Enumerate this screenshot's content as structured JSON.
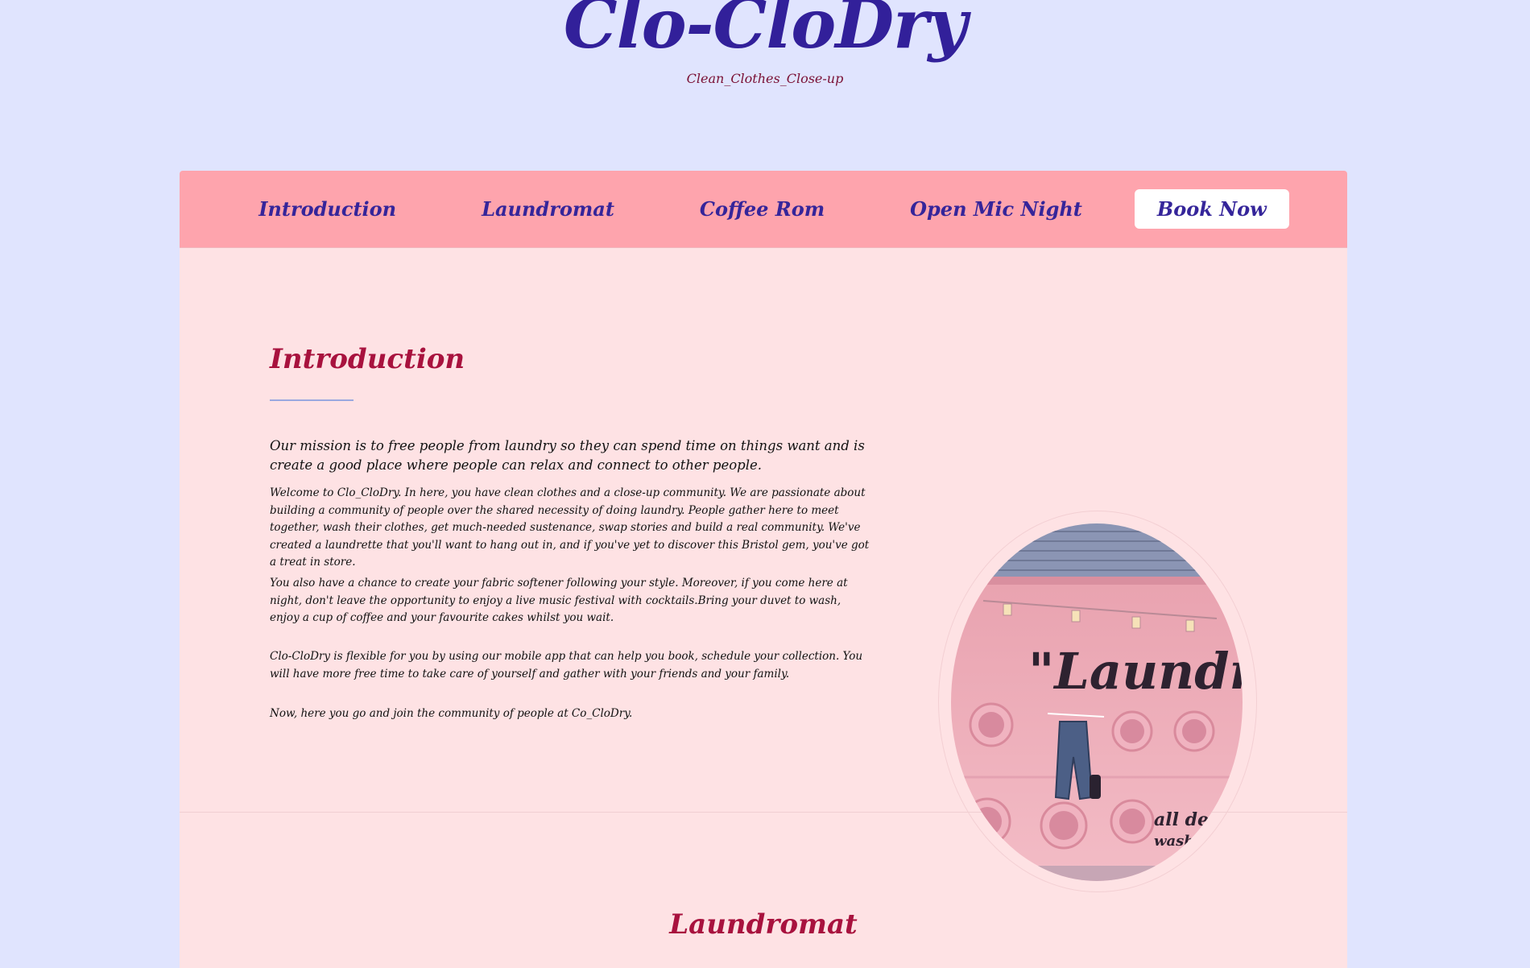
{
  "header": {
    "site_title": "Clo-CloDry",
    "tagline": "Clean_Clothes_Close-up"
  },
  "nav": {
    "items": [
      {
        "label": "Introduction"
      },
      {
        "label": "Laundromat"
      },
      {
        "label": "Coffee Rom"
      },
      {
        "label": "Open Mic Night"
      }
    ],
    "cta_label": "Book Now"
  },
  "intro": {
    "heading": "Introduction",
    "mission": "Our mission is to free people from laundry so they can spend time on things want and is create a good place where people can relax and connect to other people.",
    "paragraphs": [
      "Welcome to Clo_CloDry. In here, you have clean clothes and a close-up community. We are passionate about building a community of people over the shared necessity of doing laundry. People gather here to meet together, wash their clothes, get much-needed sustenance, swap stories and build a real community. We've created a laundrette that you'll want to hang out in, and if you've yet to discover this Bristol gem, you've got a treat in store.",
      "You also have a chance to create your fabric softener following your style. Moreover, if you come here at night, don't leave the opportunity to enjoy a live music festival with cocktails.Bring your duvet to wash, enjoy a cup of coffee and your favourite cakes whilst you wait.",
      "Clo-CloDry is flexible for you by using our mobile app that can help you book, schedule your collection. You will have more free time to take care of yourself and gather with your friends and your family.",
      "Now, here you go and join the community of people at Co_CloDry."
    ],
    "photo_sign_text": "\"Laundry",
    "photo_sign_text_2": "all deni",
    "photo_sign_text_3": "washi"
  },
  "laundromat": {
    "heading": "Laundromat"
  },
  "colors": {
    "page_bg": "#e0e4fe",
    "navbar_bg": "#fea4ad",
    "content_bg": "#fee2e4",
    "title_color": "#32209a",
    "heading_color": "#a8123e"
  }
}
